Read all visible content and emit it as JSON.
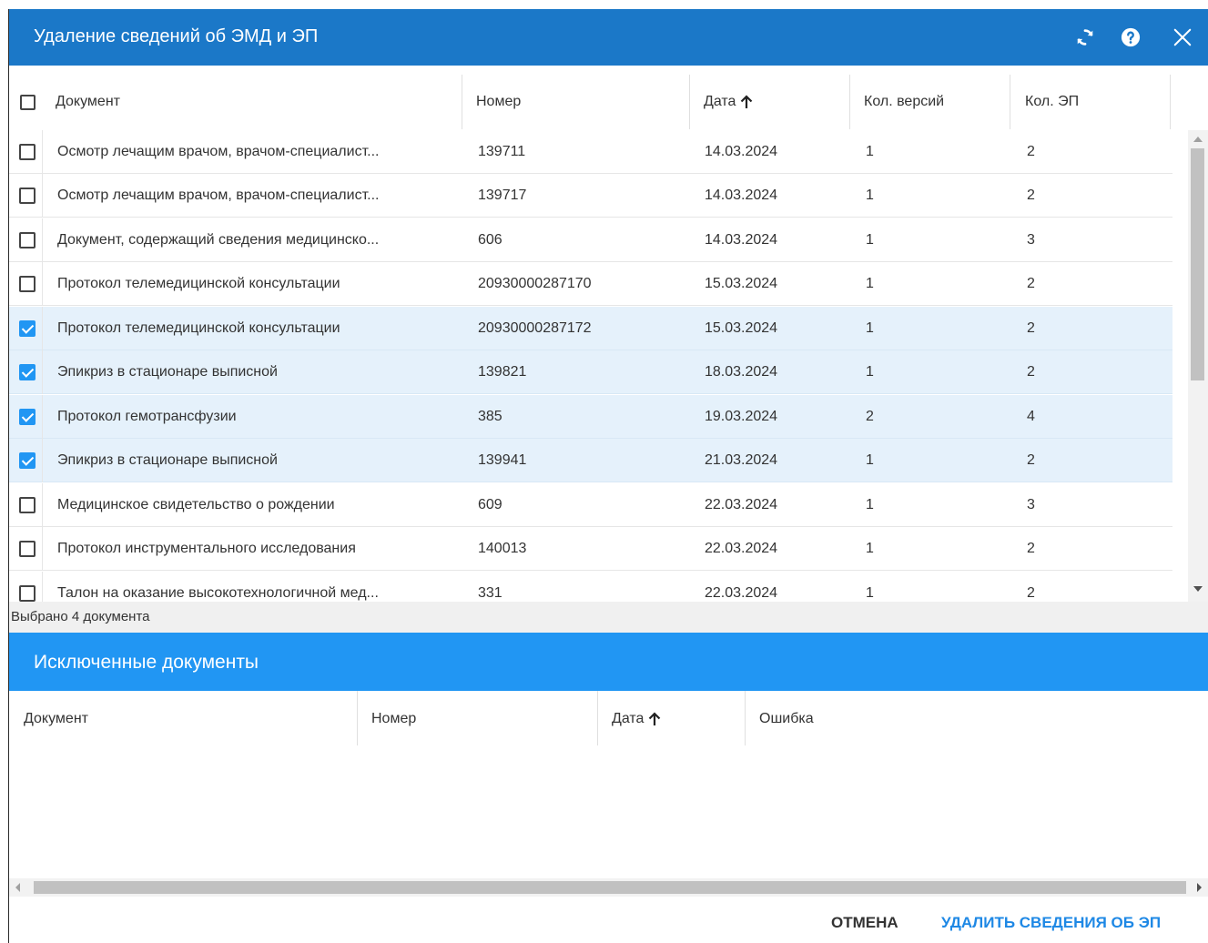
{
  "dialog": {
    "title": "Удаление сведений об ЭМД и ЭП",
    "icons": [
      "refresh-icon",
      "help-icon",
      "close-icon"
    ]
  },
  "grid": {
    "columns": {
      "document": "Документ",
      "number": "Номер",
      "date": "Дата",
      "versions": "Кол. версий",
      "signatures": "Кол. ЭП"
    },
    "sort_icon": "arrow-up-icon",
    "rows": [
      {
        "document": "Осмотр лечащим врачом, врачом-специалист...",
        "number": "139711",
        "date": "14.03.2024",
        "versions": "1",
        "signatures": "2",
        "checked": false
      },
      {
        "document": "Осмотр лечащим врачом, врачом-специалист...",
        "number": "139717",
        "date": "14.03.2024",
        "versions": "1",
        "signatures": "2",
        "checked": false
      },
      {
        "document": "Документ, содержащий сведения медицинско...",
        "number": "606",
        "date": "14.03.2024",
        "versions": "1",
        "signatures": "3",
        "checked": false
      },
      {
        "document": "Протокол телемедицинской консультации",
        "number": "20930000287170",
        "date": "15.03.2024",
        "versions": "1",
        "signatures": "2",
        "checked": false
      },
      {
        "document": "Протокол телемедицинской консультации",
        "number": "20930000287172",
        "date": "15.03.2024",
        "versions": "1",
        "signatures": "2",
        "checked": true
      },
      {
        "document": "Эпикриз в стационаре выписной",
        "number": "139821",
        "date": "18.03.2024",
        "versions": "1",
        "signatures": "2",
        "checked": true
      },
      {
        "document": "Протокол гемотрансфузии",
        "number": "385",
        "date": "19.03.2024",
        "versions": "2",
        "signatures": "4",
        "checked": true
      },
      {
        "document": "Эпикриз в стационаре выписной",
        "number": "139941",
        "date": "21.03.2024",
        "versions": "1",
        "signatures": "2",
        "checked": true
      },
      {
        "document": "Медицинское свидетельство о рождении",
        "number": "609",
        "date": "22.03.2024",
        "versions": "1",
        "signatures": "3",
        "checked": false
      },
      {
        "document": "Протокол инструментального исследования",
        "number": "140013",
        "date": "22.03.2024",
        "versions": "1",
        "signatures": "2",
        "checked": false
      },
      {
        "document": "Талон на оказание высокотехнологичной мед...",
        "number": "331",
        "date": "22.03.2024",
        "versions": "1",
        "signatures": "2",
        "checked": false
      }
    ],
    "selected_summary": "Выбрано 4 документа"
  },
  "excluded": {
    "title": "Исключенные документы",
    "columns": {
      "document": "Документ",
      "number": "Номер",
      "date": "Дата",
      "error": "Ошибка"
    }
  },
  "actions": {
    "cancel": "ОТМЕНА",
    "delete": "УДАЛИТЬ СВЕДЕНИЯ ОБ ЭП"
  },
  "colors": {
    "titlebar": "#1b78c8",
    "section": "#2196f3",
    "selected_row": "#e5f1fb",
    "primary_text_button": "#1e88e5"
  }
}
